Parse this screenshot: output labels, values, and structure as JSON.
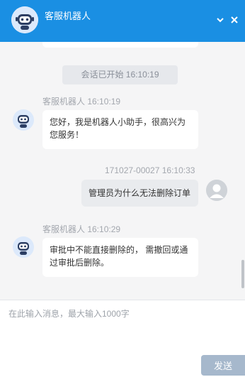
{
  "header": {
    "title": "客服机器人",
    "icons": [
      "robot-icon",
      "chevron-down-icon",
      "close-icon"
    ]
  },
  "chat": {
    "session_notice": "会话已开始 16:10:19",
    "messages": [
      {
        "from": "bot",
        "sender": "客服机器人",
        "time": "16:10:19",
        "meta": "客服机器人 16:10:19",
        "text": "您好，我是机器人小助手，很高兴为您服务！"
      },
      {
        "from": "user",
        "sender": "171027-00027",
        "time": "16:10:33",
        "meta": "171027-00027 16:10:33",
        "text": "管理员为什么无法删除订单"
      },
      {
        "from": "bot",
        "sender": "客服机器人",
        "time": "16:10:29",
        "meta": "客服机器人 16:10:29",
        "text": "审批中不能直接删除的， 需撤回或通过审批后删除。"
      }
    ]
  },
  "input": {
    "placeholder": "在此输入消息，最大输入1000字",
    "value": ""
  },
  "send_label": "发送",
  "colors": {
    "header_bg": "#1a8fe3",
    "chat_bg": "#f5f5f6",
    "send_btn": "#a6b8cc"
  }
}
